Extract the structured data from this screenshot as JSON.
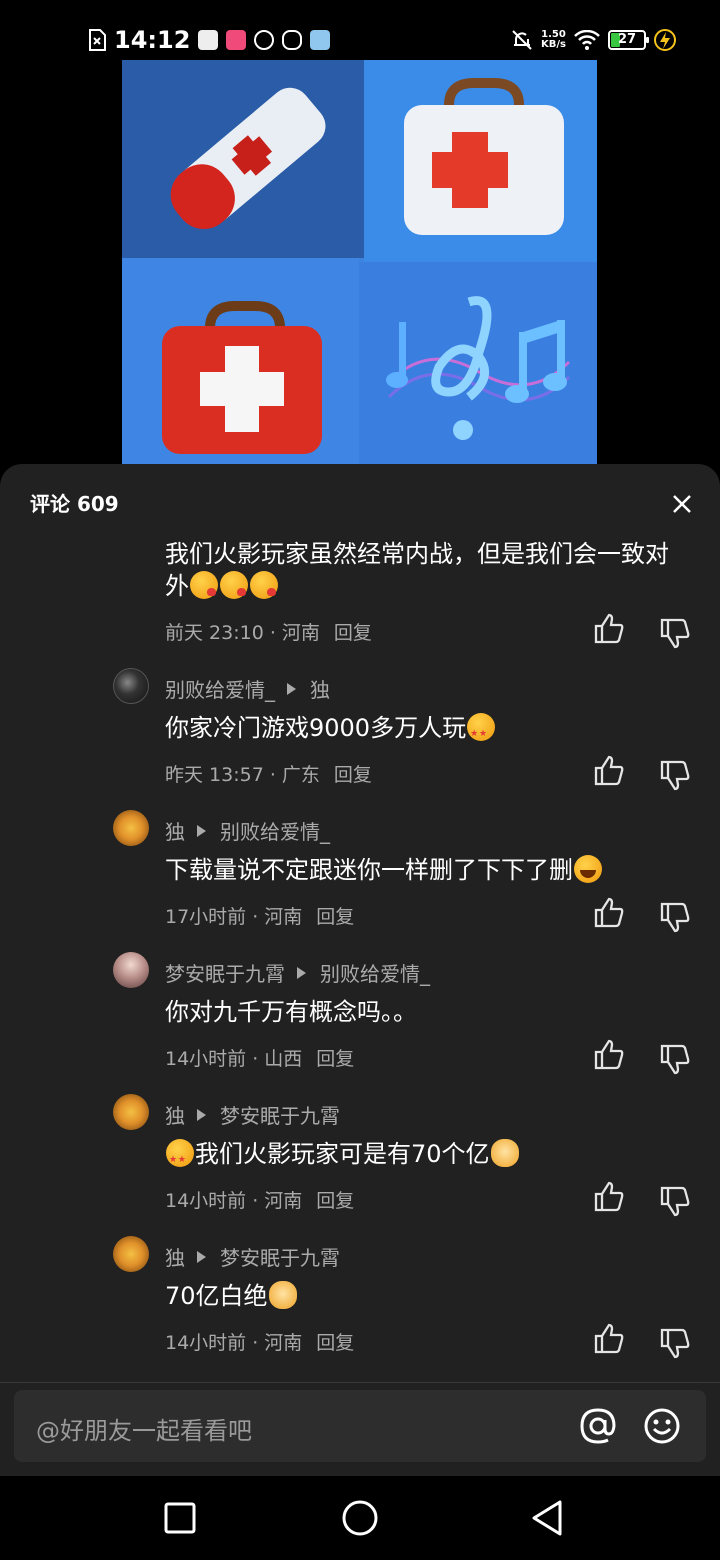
{
  "status_bar": {
    "time": "14:12",
    "net_speed_value": "1.50",
    "net_speed_unit": "KB/s",
    "battery_level": "27",
    "icons": [
      "sim-missing-icon",
      "app-icon",
      "pink-app-icon",
      "video-app-icon",
      "link-app-icon",
      "blue-app-icon",
      "mute-icon",
      "wifi-icon",
      "battery-icon",
      "charging-icon"
    ]
  },
  "sheet": {
    "title": "评论 609"
  },
  "comments": [
    {
      "text": "我们火影玩家虽然经常内战，但是我们会一致对外",
      "emojis": [
        "kiss",
        "kiss",
        "kiss"
      ],
      "time_loc": "前天 23:10 · 河南",
      "reply": "回复"
    },
    {
      "user": "别败给爱情_",
      "reply_to": "独",
      "text": "你家冷门游戏9000多万人玩",
      "emojis": [
        "star"
      ],
      "time_loc": "昨天 13:57 · 广东",
      "reply": "回复"
    },
    {
      "user": "独",
      "reply_to": "别败给爱情_",
      "text": "下载量说不定跟迷你一样删了下下了删",
      "emojis": [
        "laugh"
      ],
      "time_loc": "17小时前 · 河南",
      "reply": "回复"
    },
    {
      "user": "梦安眠于九霄",
      "reply_to": "别败给爱情_",
      "text": "你对九千万有概念吗。。",
      "time_loc": "14小时前 · 山西",
      "reply": "回复"
    },
    {
      "user": "独",
      "reply_to": "梦安眠于九霄",
      "text": "我们火影玩家可是有70个亿",
      "emojis": [
        "star",
        "doge"
      ],
      "time_loc": "14小时前 · 河南",
      "reply": "回复"
    },
    {
      "user": "独",
      "reply_to": "梦安眠于九霄",
      "text": "70亿白绝",
      "emojis": [
        "doge"
      ],
      "time_loc": "14小时前 · 河南",
      "reply": "回复"
    }
  ],
  "input": {
    "placeholder": "@好朋友一起看看吧"
  },
  "colors": {
    "sheet_bg": "#212121",
    "secondary_text": "#aaaaaa",
    "video_bg": "#3c84e0"
  }
}
